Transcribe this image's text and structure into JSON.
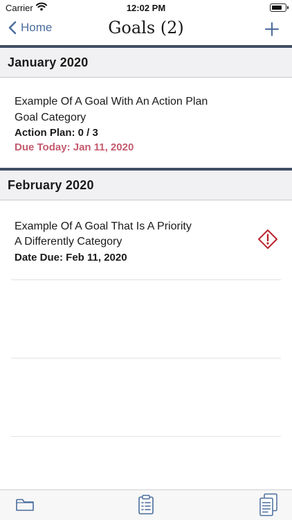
{
  "status_bar": {
    "carrier": "Carrier",
    "time": "12:02 PM"
  },
  "nav": {
    "back_label": "Home",
    "title": "Goals (2)",
    "accent_color": "#4a6c9c"
  },
  "sections": [
    {
      "header": "January 2020",
      "goals": [
        {
          "title": "Example Of A Goal With An Action Plan",
          "category": "Goal Category",
          "detail": "Action Plan:  0 / 3",
          "due": "Due Today: Jan 11, 2020",
          "due_color": "#c45b6e"
        }
      ]
    },
    {
      "header": "February 2020",
      "goals": [
        {
          "title": "Example Of A Goal That Is A Priority",
          "category": "A Differently Category",
          "due": "Date Due: Feb 11, 2020",
          "priority_icon": "warning-diamond-icon",
          "priority_color": "#b8252e"
        }
      ]
    }
  ],
  "tab_bar": {
    "icons": [
      "folder-icon",
      "clipboard-list-icon",
      "documents-list-icon"
    ]
  }
}
